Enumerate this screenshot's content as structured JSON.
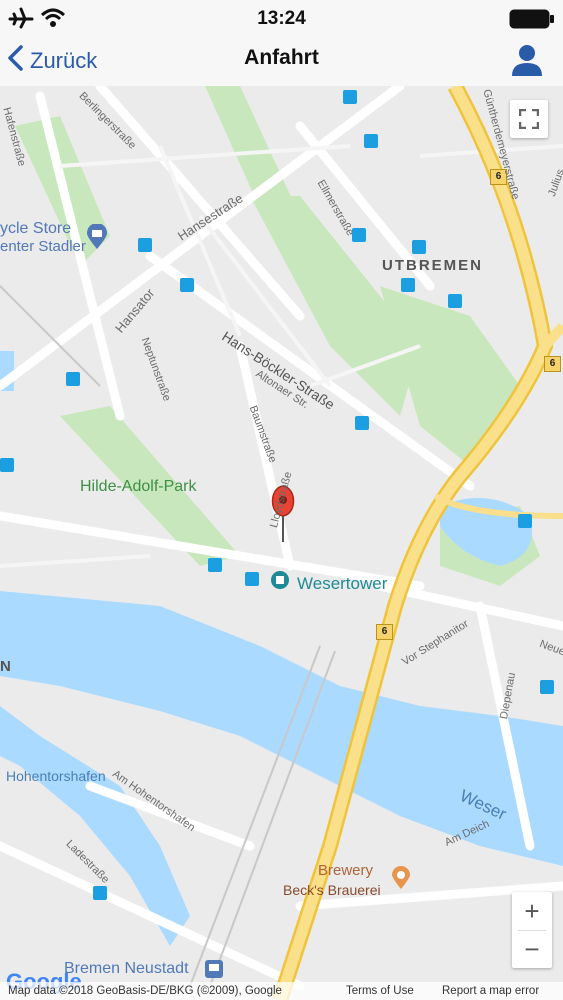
{
  "status_bar": {
    "time": "13:24"
  },
  "nav_bar": {
    "back_label": "Zurück",
    "title": "Anfahrt"
  },
  "map": {
    "streets": {
      "hansestrasse": "Hansestraße",
      "hansator": "Hansator",
      "hans_boeckler": "Hans-Böckler-Straße",
      "neptunstrasse": "Neptunstraße",
      "baumstrasse": "Baumstraße",
      "altonaer": "Altonaer Str.",
      "lloydstrasse": "Lloydstraße",
      "ellmerstrasse": "Ellmerstraße",
      "hafenstrasse": "Hafenstraße",
      "bertinger": "Berlingerstraße",
      "vor_stephanitor": "Vor Stephanitor",
      "am_hohentorshafen": "Am Hohentorshafen",
      "ladestrasse": "Ladestraße",
      "diepenau": "Diepenau",
      "am_deich": "Am Deich",
      "neuenland": "Neuenl",
      "gunterdemey": "Güntherdemeyerstraße",
      "julius": "Julius"
    },
    "places": {
      "cycle_store_line1": "ycle Store",
      "cycle_store_line2": "enter Stadler",
      "hilde_adolf_park": "Hilde-Adolf-Park",
      "wesertower": "Wesertower",
      "utbremen": "UTBREMEN",
      "weser": "Weser",
      "hohentorshafen": "Hohentorshafen",
      "brewery": "Brewery",
      "becks": "Beck's Brauerei",
      "bremen_neustadt": "Bremen Neustadt",
      "n_edge": "N"
    },
    "highway_number": "6",
    "google_logo": "Google",
    "zoom_in": "+",
    "zoom_out": "−",
    "attribution": {
      "data": "Map data ©2018 GeoBasis-DE/BKG (©2009), Google",
      "terms": "Terms of Use",
      "report": "Report a map error"
    }
  }
}
